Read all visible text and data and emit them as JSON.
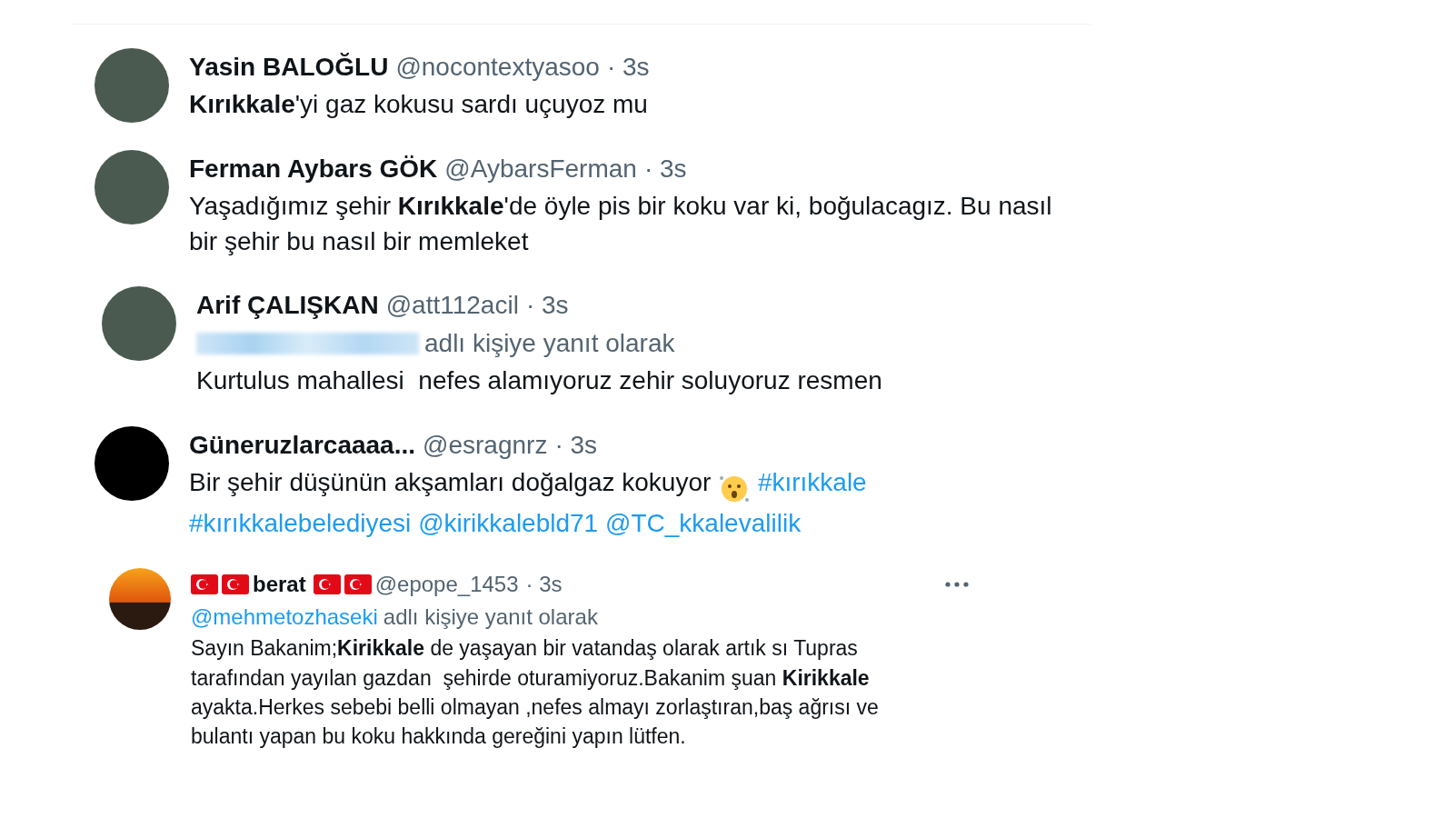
{
  "tweets": [
    {
      "avatar": {
        "kind": "photo"
      },
      "name_parts": [
        {
          "kind": "text",
          "text": "Yasin BALOĞLU"
        }
      ],
      "handle": "@nocontextyasoo",
      "time": "· 3s",
      "segments": [
        {
          "kind": "text",
          "text": "**Kırıkkale**'yi gaz kokusu sardı uçuyoz mu"
        }
      ]
    },
    {
      "avatar": {
        "kind": "photo"
      },
      "name_parts": [
        {
          "kind": "text",
          "text": "Ferman Aybars GÖK"
        }
      ],
      "handle": "@AybarsFerman",
      "time": "· 3s",
      "segments": [
        {
          "kind": "text",
          "text": "Yaşadığımız şehir **Kırıkkale**'de öyle pis bir koku var ki, boğulacagız. Bu nasıl\nbir şehir bu nasıl bir memleket"
        }
      ]
    },
    {
      "avatar": {
        "kind": "photo"
      },
      "name_parts": [
        {
          "kind": "text",
          "text": "Arif ÇALIŞKAN"
        }
      ],
      "handle": "@att112acil",
      "time": "· 3s",
      "reply": {
        "redacted": true,
        "label": "adlı kişiye yanıt olarak"
      },
      "segments": [
        {
          "kind": "text",
          "text": "Kurtulus mahallesi  nefes alamıyoruz zehir soluyoruz resmen"
        }
      ]
    },
    {
      "avatar": {
        "kind": "blank"
      },
      "name_parts": [
        {
          "kind": "text",
          "text": "Güneruzlarcaaaa..."
        }
      ],
      "handle": "@esragnrz",
      "time": "· 3s",
      "segments": [
        {
          "kind": "text",
          "text": "Bir şehir düşünün akşamları doğalgaz kokuyor "
        },
        {
          "kind": "emoji"
        },
        {
          "kind": "link",
          "text": "#kırıkkale"
        },
        {
          "kind": "break"
        },
        {
          "kind": "link",
          "text": "#kırıkkalebelediyesi"
        },
        {
          "kind": "link",
          "text": "@kirikkalebld71"
        },
        {
          "kind": "link",
          "text": "@TC_kkalevalilik"
        }
      ]
    },
    {
      "avatar": {
        "kind": "sunset"
      },
      "more": true,
      "name_parts": [
        {
          "kind": "flag"
        },
        {
          "kind": "flag"
        },
        {
          "kind": "text",
          "text": "berat"
        },
        {
          "kind": "flag"
        },
        {
          "kind": "flag"
        }
      ],
      "handle": "@epope_1453",
      "time": "· 3s",
      "reply": {
        "redacted": false,
        "handle": "@mehmetozhaseki",
        "label": "adlı kişiye yanıt olarak"
      },
      "segments": [
        {
          "kind": "text",
          "text": "Sayın Bakanim;**Kirikkale** de yaşayan bir vatandaş olarak artık sı Tupras\ntarafından yayılan gazdan  şehirde oturamiyoruz.Bakanim şuan **Kirikkale**\nayakta.Herkes sebebi belli olmayan ,nefes almayı zorlaştıran,baş ağrısı ve\nbulantı yapan bu koku hakkında gereğini yapın lütfen."
        }
      ]
    }
  ]
}
